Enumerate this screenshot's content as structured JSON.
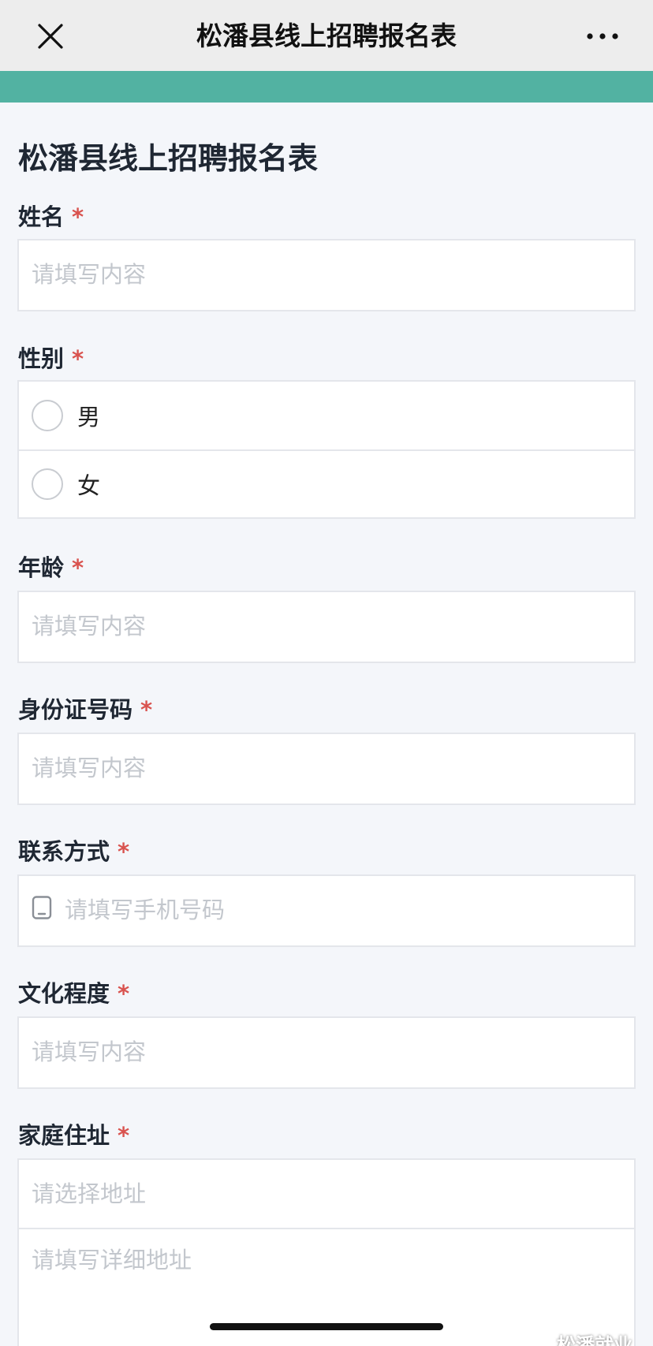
{
  "navbar": {
    "title": "松潘县线上招聘报名表",
    "close_icon": "close-icon",
    "more_icon": "more-icon"
  },
  "colors": {
    "accent": "#52b2a2",
    "required": "#d9534f",
    "placeholder": "#c3c7cd"
  },
  "form": {
    "title": "松潘县线上招聘报名表",
    "required_mark": "*",
    "name": {
      "label": "姓名",
      "placeholder": "请填写内容"
    },
    "gender": {
      "label": "性别",
      "options": [
        "男",
        "女"
      ]
    },
    "age": {
      "label": "年龄",
      "placeholder": "请填写内容"
    },
    "id_number": {
      "label": "身份证号码",
      "placeholder": "请填写内容"
    },
    "contact": {
      "label": "联系方式",
      "placeholder": "请填写手机号码",
      "icon": "phone-icon"
    },
    "education": {
      "label": "文化程度",
      "placeholder": "请填写内容"
    },
    "address": {
      "label": "家庭住址",
      "select_placeholder": "请选择地址",
      "detail_placeholder": "请填写详细地址"
    }
  },
  "watermark": {
    "text": "松潘就业"
  }
}
